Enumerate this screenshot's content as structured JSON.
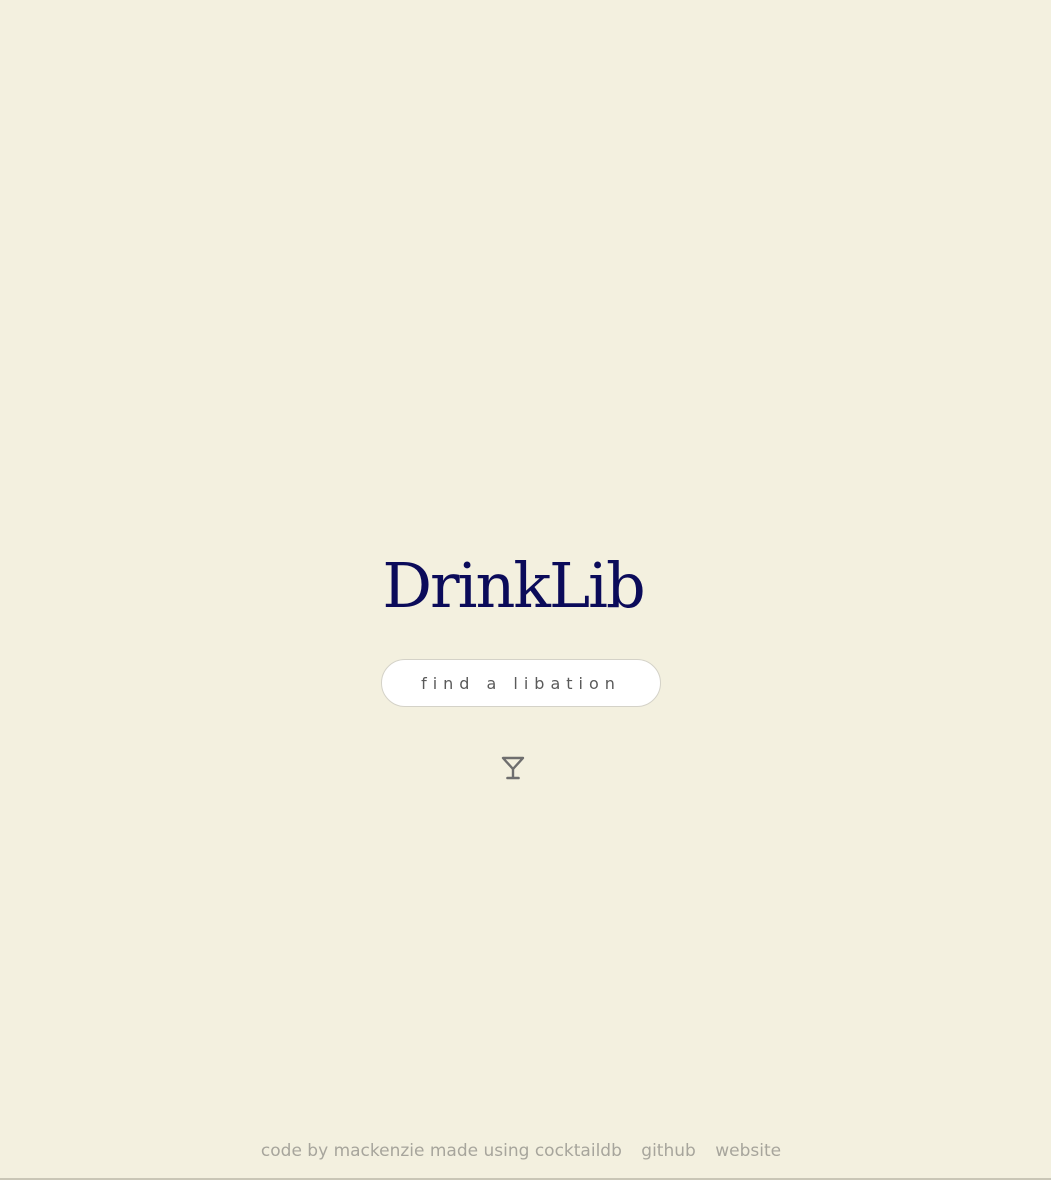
{
  "app": {
    "title": "DrinkLib"
  },
  "search": {
    "placeholder": "find a libation",
    "value": ""
  },
  "search_button": {
    "icon": "cocktail-glass-icon"
  },
  "footer": {
    "credit": "code by mackenzie made using cocktaildb",
    "github_label": "github",
    "website_label": "website"
  },
  "colors": {
    "background": "#f3f0df",
    "title": "#0b0b5a",
    "footer_text": "#a7a59c",
    "icon": "#6e6e6e"
  }
}
